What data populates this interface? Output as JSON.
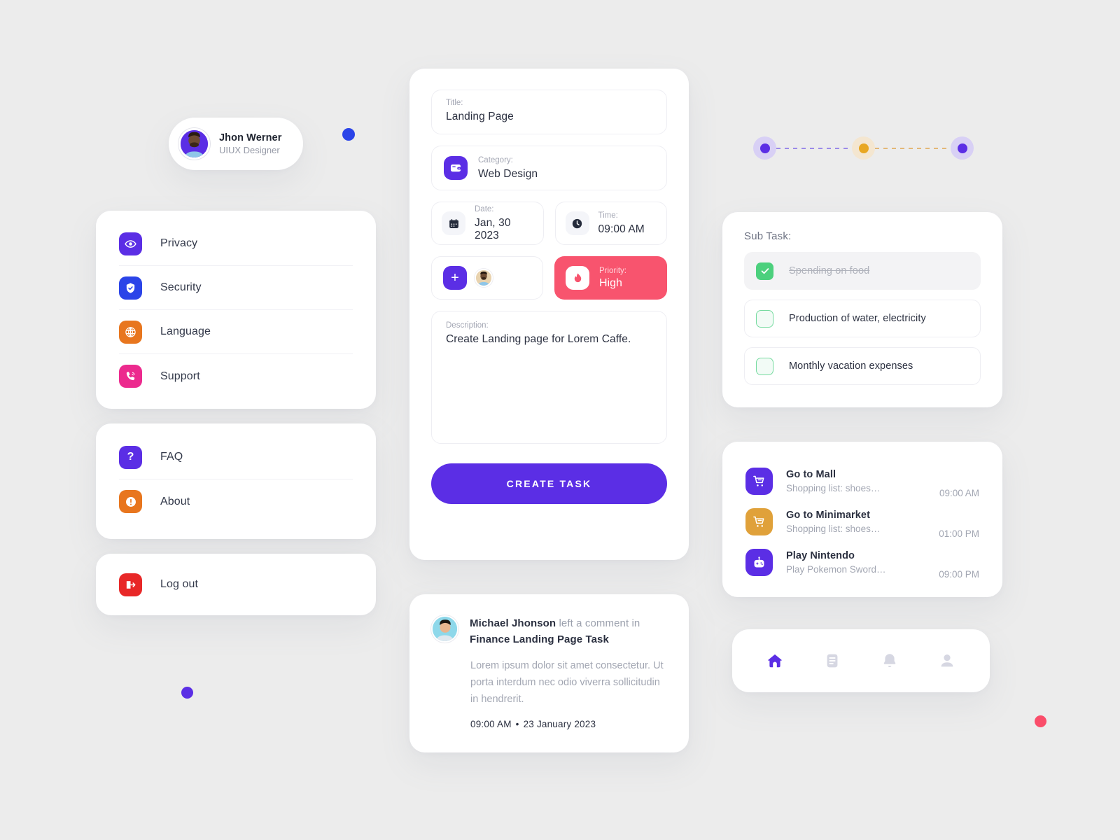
{
  "profile": {
    "name": "Jhon Werner",
    "role": "UIUX Designer",
    "avatar_icon": "user-avatar"
  },
  "menu": {
    "group1": [
      {
        "label": "Privacy",
        "icon": "eye-icon",
        "color": "#5b2ee5"
      },
      {
        "label": "Security",
        "icon": "shield-icon",
        "color": "#2b44e8"
      },
      {
        "label": "Language",
        "icon": "globe-icon",
        "color": "#e8761e"
      },
      {
        "label": "Support",
        "icon": "phone-icon",
        "color": "#ec2a8e"
      }
    ],
    "group2": [
      {
        "label": "FAQ",
        "icon": "question-icon",
        "color": "#5b2ee5"
      },
      {
        "label": "About",
        "icon": "info-icon",
        "color": "#e8761e"
      }
    ],
    "group3": [
      {
        "label": "Log out",
        "icon": "logout-icon",
        "color": "#e82828"
      }
    ]
  },
  "task_form": {
    "title_label": "Title:",
    "title_value": "Landing Page",
    "category_label": "Category:",
    "category_value": "Web Design",
    "category_icon": "wallet-icon",
    "date_label": "Date:",
    "date_value": "Jan, 30 2023",
    "date_icon": "calendar-icon",
    "time_label": "Time:",
    "time_value": "09:00 AM",
    "time_icon": "clock-icon",
    "add_assignee_label": "+",
    "assignee_avatar": "assignee-avatar",
    "priority_label": "Priority:",
    "priority_value": "High",
    "priority_icon": "flame-icon",
    "priority_color": "#f8546e",
    "description_label": "Description:",
    "description_value": "Create Landing page for Lorem Caffe.",
    "submit_label": "CREATE TASK",
    "accent_color": "#5b2ee5"
  },
  "comment": {
    "author": "Michael Jhonson",
    "action": " left a comment in",
    "target": "Finance Landing Page Task",
    "body": "Lorem ipsum dolor sit amet consectetur. Ut porta interdum nec odio viverra sollicitudin in hendrerit.",
    "time": "09:00 AM",
    "separator": "•",
    "date": "23 January 2023"
  },
  "stepper": {
    "steps": [
      {
        "core": "#5b2ee5",
        "halo": "#d8d0f5"
      },
      {
        "core": "#e8a722",
        "halo": "#f4e6d0"
      },
      {
        "core": "#5b2ee5",
        "halo": "#d8d0f5"
      }
    ],
    "line_colors": [
      "#9b8ae8",
      "#e3b877"
    ]
  },
  "subtask": {
    "heading": "Sub Task:",
    "items": [
      {
        "text": "Spending on food",
        "done": true
      },
      {
        "text": "Production of water, electricity",
        "done": false
      },
      {
        "text": "Monthly vacation expenses",
        "done": false
      }
    ]
  },
  "activity": {
    "items": [
      {
        "title": "Go to Mall",
        "subtitle": "Shopping list: shoes…",
        "time": "09:00 AM",
        "icon": "cart-icon",
        "color": "#5b2ee5"
      },
      {
        "title": "Go to Minimarket",
        "subtitle": "Shopping list: shoes…",
        "time": "01:00 PM",
        "icon": "cart-icon",
        "color": "#e0a13a"
      },
      {
        "title": "Play Nintendo",
        "subtitle": "Play Pokemon Sword…",
        "time": "09:00 PM",
        "icon": "gamepad-icon",
        "color": "#5b2ee5"
      }
    ]
  },
  "navbar": {
    "items": [
      {
        "icon": "home-icon",
        "active": true
      },
      {
        "icon": "list-icon",
        "active": false
      },
      {
        "icon": "bell-icon",
        "active": false
      },
      {
        "icon": "profile-icon",
        "active": false
      }
    ]
  },
  "decor": {
    "dot_blue": "#2b44e8",
    "dot_purple": "#5b2ee5",
    "dot_pink": "#fa4d6a"
  }
}
